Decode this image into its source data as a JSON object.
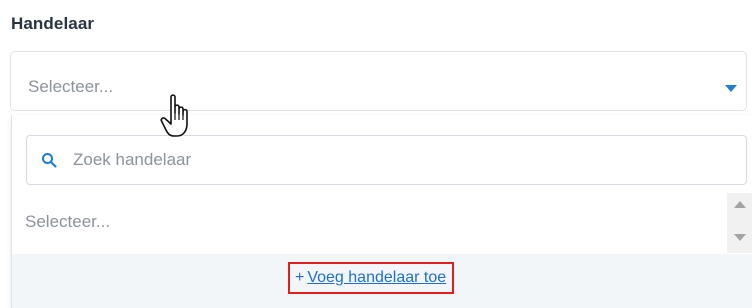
{
  "field": {
    "label": "Handelaar",
    "select_value": "Selecteer..."
  },
  "dropdown": {
    "search_placeholder": "Zoek handelaar",
    "options": [
      {
        "label": "Selecteer..."
      }
    ],
    "add_link": {
      "plus": "+",
      "label": "Voeg handelaar toe"
    }
  },
  "colors": {
    "accent": "#1f7dd4",
    "link": "#1f6fd0",
    "highlight_border": "#e0201f"
  },
  "icons": {
    "caret": "chevron-down-icon",
    "search": "search-icon",
    "cursor": "hand-pointer-icon"
  }
}
